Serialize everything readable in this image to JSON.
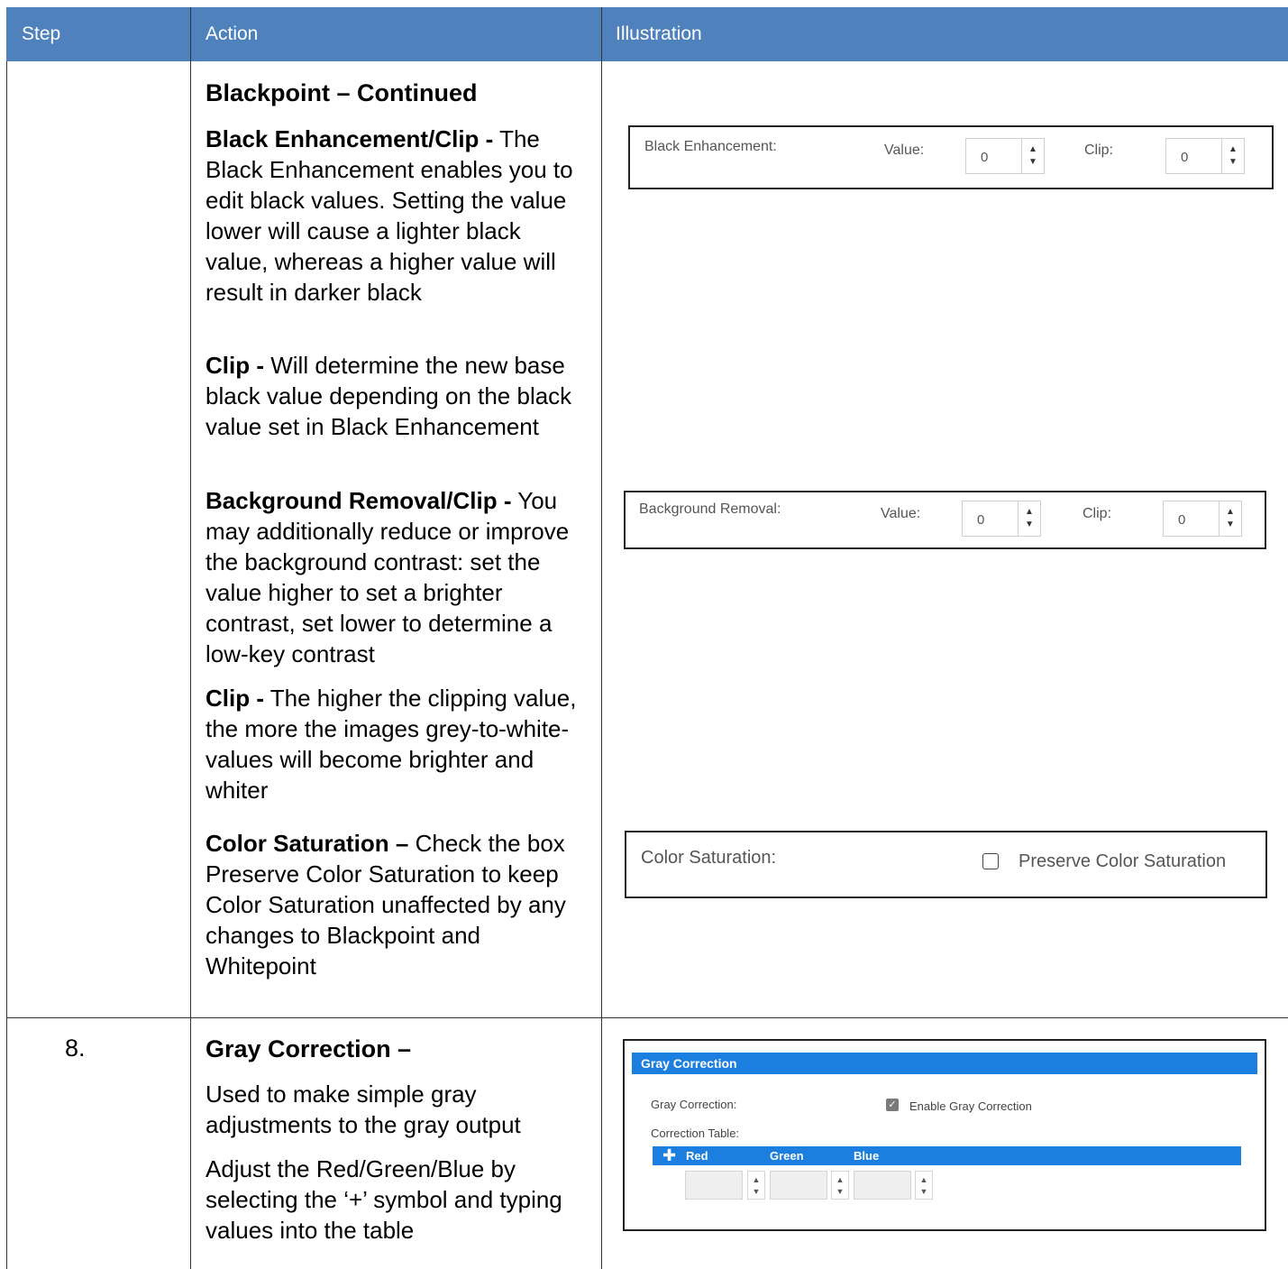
{
  "header": {
    "step": "Step",
    "action": "Action",
    "illustration": "Illustration"
  },
  "row1": {
    "title": "Blackpoint – Continued",
    "p1_term": "Black Enhancement/Clip -",
    "p1_text": " The Black Enhancement enables you to edit black values. Setting the value lower will cause a lighter black value, whereas a higher value will result in darker black",
    "p2_term": "Clip -",
    "p2_text": " Will determine the new base black value depending on the black value set in Black Enhancement",
    "p3_term": "Background Removal/Clip -",
    "p3_text": " You may additionally reduce or improve the background contrast: set the value higher to set a brighter contrast, set lower to determine a low-key contrast",
    "p4_term": "Clip -",
    "p4_text": " The higher the clipping value, the more the images grey-to-white-values will become brighter and whiter",
    "p5_term": "Color Saturation –",
    "p5_text": " Check the box Preserve Color Saturation to keep Color Saturation unaffected by any changes to Blackpoint and Whitepoint"
  },
  "row2": {
    "step": "8.",
    "title": "Gray Correction –",
    "p1": "Used to make simple gray adjustments to the gray output",
    "p2": "Adjust the Red/Green/Blue by selecting the ‘+’ symbol and typing values into the table"
  },
  "black_enh": {
    "label": "Black Enhancement:",
    "value_label": "Value:",
    "value": "0",
    "clip_label": "Clip:",
    "clip": "0"
  },
  "bg_removal": {
    "label": "Background Removal:",
    "value_label": "Value:",
    "value": "0",
    "clip_label": "Clip:",
    "clip": "0"
  },
  "color_sat": {
    "label": "Color Saturation:",
    "checkbox_label": "Preserve Color Saturation",
    "checked": false
  },
  "gray_corr": {
    "title": "Gray Correction",
    "field_label": "Gray Correction:",
    "checkbox_label": "Enable Gray Correction",
    "checked": true,
    "table_label": "Correction Table:",
    "columns": [
      "Red",
      "Green",
      "Blue"
    ],
    "accent": "#1c7fdf"
  },
  "colors": {
    "header_bg": "#4f81bd"
  }
}
